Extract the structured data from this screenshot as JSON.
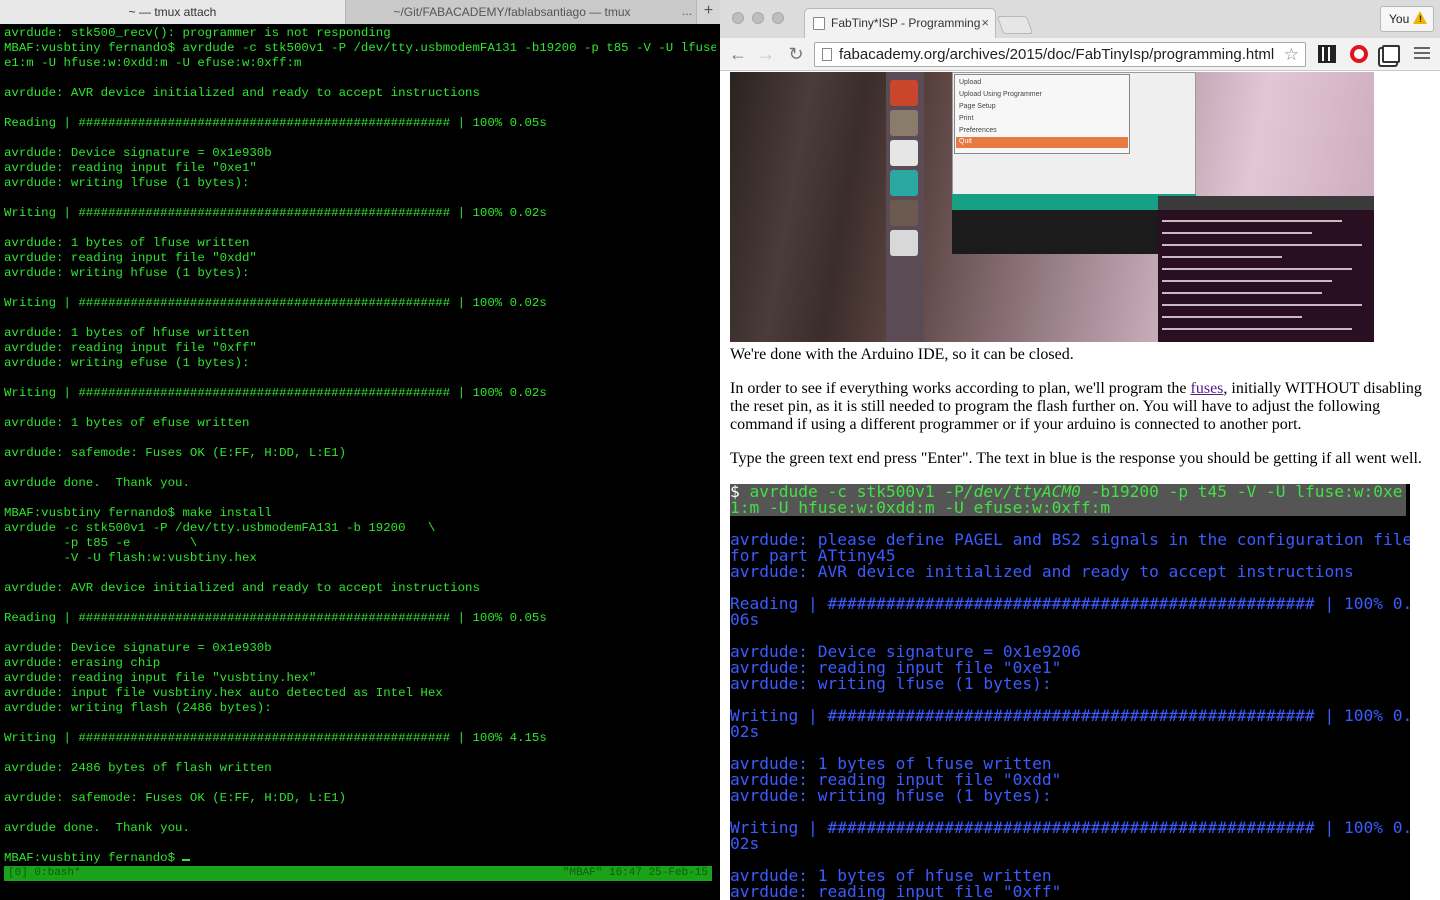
{
  "terminal": {
    "tabs": {
      "active": "~ — tmux attach",
      "inactive": "~/Git/FABACADEMY/fablabsantiago — tmux",
      "more": "...",
      "add": "+"
    },
    "lines": [
      "avrdude: stk500_recv(): programmer is not responding",
      "MBAF:vusbtiny fernando$ avrdude -c stk500v1 -P /dev/tty.usbmodemFA131 -b19200 -p t85 -V -U lfuse:w:0x",
      "e1:m -U hfuse:w:0xdd:m -U efuse:w:0xff:m",
      "",
      "avrdude: AVR device initialized and ready to accept instructions",
      "",
      "Reading | ################################################## | 100% 0.05s",
      "",
      "avrdude: Device signature = 0x1e930b",
      "avrdude: reading input file \"0xe1\"",
      "avrdude: writing lfuse (1 bytes):",
      "",
      "Writing | ################################################## | 100% 0.02s",
      "",
      "avrdude: 1 bytes of lfuse written",
      "avrdude: reading input file \"0xdd\"",
      "avrdude: writing hfuse (1 bytes):",
      "",
      "Writing | ################################################## | 100% 0.02s",
      "",
      "avrdude: 1 bytes of hfuse written",
      "avrdude: reading input file \"0xff\"",
      "avrdude: writing efuse (1 bytes):",
      "",
      "Writing | ################################################## | 100% 0.02s",
      "",
      "avrdude: 1 bytes of efuse written",
      "",
      "avrdude: safemode: Fuses OK (E:FF, H:DD, L:E1)",
      "",
      "avrdude done.  Thank you.",
      "",
      "MBAF:vusbtiny fernando$ make install",
      "avrdude -c stk500v1 -P /dev/tty.usbmodemFA131 -b 19200   \\",
      "        -p t85 -e        \\",
      "        -V -U flash:w:vusbtiny.hex",
      "",
      "avrdude: AVR device initialized and ready to accept instructions",
      "",
      "Reading | ################################################## | 100% 0.05s",
      "",
      "avrdude: Device signature = 0x1e930b",
      "avrdude: erasing chip",
      "avrdude: reading input file \"vusbtiny.hex\"",
      "avrdude: input file vusbtiny.hex auto detected as Intel Hex",
      "avrdude: writing flash (2486 bytes):",
      "",
      "Writing | ################################################## | 100% 4.15s",
      "",
      "avrdude: 2486 bytes of flash written",
      "",
      "avrdude: safemode: Fuses OK (E:FF, H:DD, L:E1)",
      "",
      "avrdude done.  Thank you.",
      "",
      "MBAF:vusbtiny fernando$ "
    ],
    "status_left": "[0] 0:bash*",
    "status_right": "\"MBAF\" 16:47 25-Feb-15"
  },
  "browser": {
    "tab_title": "FabTiny*ISP - Programming",
    "tab_close": "×",
    "profile_label": "You",
    "profile_warning": "!",
    "url": "fabacademy.org/archives/2015/doc/FabTinyIsp/programming.html",
    "nav": {
      "back": "←",
      "forward": "→",
      "reload": "↻",
      "star": "☆"
    },
    "photo_menu": [
      "Upload",
      "Upload Using Programmer",
      "Page Setup",
      "Print",
      "Preferences",
      "Quit"
    ],
    "paragraph_1": "We're done with the Arduino IDE, so it can be closed.",
    "paragraph_2_before": "In order to see if everything works according to plan, we'll program the ",
    "paragraph_2_link": "fuses",
    "paragraph_2_after": ", initially WITHOUT disabling the reset pin, as it is still needed to program the flash further on. You will have to adjust the following command if using a different programmer or if your arduino is connected to another port.",
    "paragraph_3": "Type the green text end press \"Enter\". The text in blue is the response you should be getting if all went well.",
    "code": {
      "prompt": "$ ",
      "cmd_a": "avrdude -c stk500v1 -P",
      "cmd_italic": "/dev/ttyACM0",
      "cmd_b": " -b19200 -p t45 -V -U lfuse:w:0xe",
      "cmd_line2": "1:m -U hfuse:w:0xdd:m -U efuse:w:0xff:m",
      "lines": [
        "",
        "avrdude: please define PAGEL and BS2 signals in the configuration file",
        "for part ATtiny45",
        "avrdude: AVR device initialized and ready to accept instructions",
        "",
        "Reading | ################################################## | 100% 0.",
        "06s",
        "",
        "avrdude: Device signature = 0x1e9206",
        "avrdude: reading input file \"0xe1\"",
        "avrdude: writing lfuse (1 bytes):",
        "",
        "Writing | ################################################## | 100% 0.",
        "02s",
        "",
        "avrdude: 1 bytes of lfuse written",
        "avrdude: reading input file \"0xdd\"",
        "avrdude: writing hfuse (1 bytes):",
        "",
        "Writing | ################################################## | 100% 0.",
        "02s",
        "",
        "avrdude: 1 bytes of hfuse written",
        "avrdude: reading input file \"0xff\""
      ]
    }
  },
  "colors": {
    "terminal_text": "#2ee62e",
    "tmux_status": "#1aa31a",
    "code_response": "#3b5cff",
    "code_command": "#44e044",
    "link": "#551a8b"
  }
}
